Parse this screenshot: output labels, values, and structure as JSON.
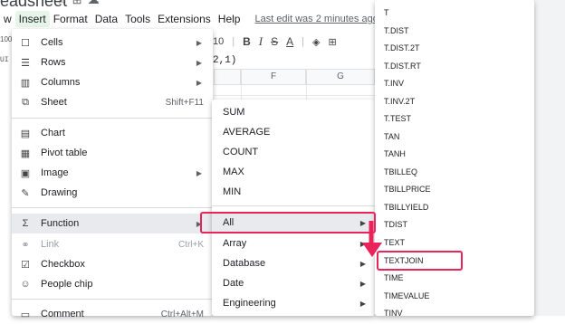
{
  "doc": {
    "title": "eadsheet",
    "icons": [
      "star-icon",
      "move-to-folder-icon",
      "cloud-status-icon"
    ]
  },
  "menubar": {
    "items": [
      "w",
      "Insert",
      "Format",
      "Data",
      "Tools",
      "Extensions",
      "Help"
    ],
    "active": "Insert",
    "last_edit": "Last edit was 2 minutes ago"
  },
  "toolbar": {
    "font_size": "10",
    "bold": "B",
    "italic": "I",
    "strike": "S",
    "text_color": "A"
  },
  "left_fragments": [
    "100",
    "UI"
  ],
  "formula_fragment": "2,1)",
  "columns": [
    "F",
    "G"
  ],
  "insert_menu": {
    "items": [
      {
        "icon": "cells-icon",
        "label": "Cells",
        "shortcut": "",
        "submenu": true
      },
      {
        "icon": "rows-icon",
        "label": "Rows",
        "shortcut": "",
        "submenu": true
      },
      {
        "icon": "columns-icon",
        "label": "Columns",
        "shortcut": "",
        "submenu": true
      },
      {
        "icon": "sheet-icon",
        "label": "Sheet",
        "shortcut": "Shift+F11",
        "submenu": false
      },
      {
        "icon": "chart-icon",
        "label": "Chart",
        "shortcut": "",
        "submenu": false
      },
      {
        "icon": "pivot-table-icon",
        "label": "Pivot table",
        "shortcut": "",
        "submenu": false
      },
      {
        "icon": "image-icon",
        "label": "Image",
        "shortcut": "",
        "submenu": true
      },
      {
        "icon": "drawing-icon",
        "label": "Drawing",
        "shortcut": "",
        "submenu": false
      },
      {
        "icon": "function-icon",
        "label": "Function",
        "shortcut": "",
        "submenu": true
      },
      {
        "icon": "link-icon",
        "label": "Link",
        "shortcut": "Ctrl+K",
        "submenu": false
      },
      {
        "icon": "checkbox-icon",
        "label": "Checkbox",
        "shortcut": "",
        "submenu": false
      },
      {
        "icon": "people-chip-icon",
        "label": "People chip",
        "shortcut": "",
        "submenu": false
      },
      {
        "icon": "comment-icon",
        "label": "Comment",
        "shortcut": "Ctrl+Alt+M",
        "submenu": false
      }
    ]
  },
  "function_menu": {
    "quick": [
      "SUM",
      "AVERAGE",
      "COUNT",
      "MAX",
      "MIN"
    ],
    "categories": [
      "All",
      "Array",
      "Database",
      "Date",
      "Engineering"
    ]
  },
  "all_functions": [
    "T",
    "T.DIST",
    "T.DIST.2T",
    "T.DIST.RT",
    "T.INV",
    "T.INV.2T",
    "T.TEST",
    "TAN",
    "TANH",
    "TBILLEQ",
    "TBILLPRICE",
    "TBILLYIELD",
    "TDIST",
    "TEXT",
    "TEXTJOIN",
    "TIME",
    "TIMEVALUE",
    "TINV"
  ],
  "colors": {
    "callout": "#e8245b",
    "menubar_active": "#e6f4ea",
    "hover": "#e8eaed"
  }
}
